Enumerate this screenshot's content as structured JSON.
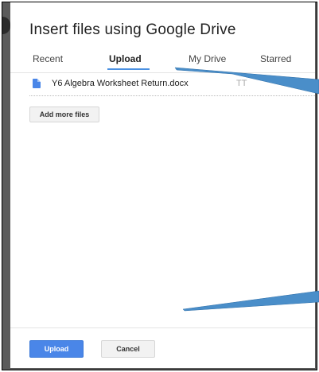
{
  "dialog": {
    "title": "Insert files using Google Drive",
    "tabs": [
      {
        "label": "Recent",
        "active": false
      },
      {
        "label": "Upload",
        "active": true
      },
      {
        "label": "My Drive",
        "active": false
      },
      {
        "label": "Starred",
        "active": false
      }
    ],
    "file": {
      "name": "Y6 Algebra Worksheet Return.docx",
      "status": "TT"
    },
    "add_more_label": "Add more files",
    "upload_label": "Upload",
    "cancel_label": "Cancel"
  },
  "colors": {
    "accent": "#4a86e8",
    "tab_underline": "#4a90e2",
    "annotation_arrow": "#4a8ec9",
    "backdrop": "#5b5b5b"
  },
  "icons": [
    "document-icon"
  ]
}
